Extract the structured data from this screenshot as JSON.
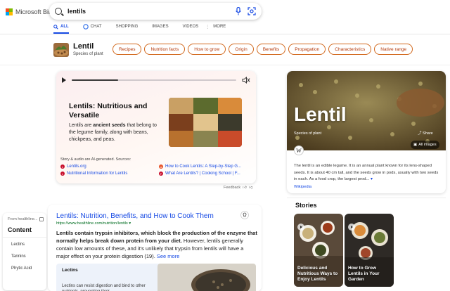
{
  "header": {
    "brand": "Microsoft Bing",
    "brand_colors": [
      "#f25022",
      "#7fba00",
      "#00a4ef",
      "#ffb900"
    ],
    "search_value": "lentils",
    "accent": "#174ae4"
  },
  "nav": {
    "all": "ALL",
    "chat": "CHAT",
    "shopping": "SHOPPING",
    "images": "IMAGES",
    "videos": "VIDEOS",
    "more": "MORE"
  },
  "entity": {
    "title": "Lentil",
    "subtitle": "Species of plant",
    "pills": [
      "Recipes",
      "Nutrition facts",
      "How to grow",
      "Origin",
      "Benefits",
      "Propagation",
      "Characteristics",
      "Native range"
    ]
  },
  "audio_card": {
    "progress": 0.28,
    "title": "Lentils: Nutritious and Versatile",
    "body_pre": "Lentils are ",
    "body_bold": "ancient seeds",
    "body_post": " that belong to the legume family, along with beans, chickpeas, and peas.",
    "sources_label": "Story & audio are AI-generated. Sources:",
    "sources": [
      "Lentils.org",
      "Nutritional Information for Lentils",
      "How to Cook Lentils: A Step-by-Step G...",
      "What Are Lentils? | Cooking School | F..."
    ],
    "feedback": "Feedback"
  },
  "knowledge_panel": {
    "title": "Lentil",
    "subtitle": "Species of plant",
    "share": "Share",
    "all_images": "All images",
    "description": "The lentil is an edible legume. It is an annual plant known for its lens-shaped seeds. It is about 40 cm tall, and the seeds grow in pods, usually with two seeds in each. As a food crop, the largest prod...",
    "more_arrow": "▾",
    "source": "Wikipedia"
  },
  "stories": {
    "title": "Stories",
    "items": [
      "Delicious and Nutritious Ways to Enjoy Lentils",
      "How to Grow Lentils in Your Garden"
    ]
  },
  "toc": {
    "from": "From healthline...",
    "title": "Content",
    "items": [
      "Lectins",
      "Tannins",
      "Phytic Acid"
    ]
  },
  "result": {
    "title": "Lentils: Nutrition, Benefits, and How to Cook Them",
    "url": "https://www.healthline.com/nutrition/lentils",
    "snippet_bold": "Lentils contain trypsin inhibitors, which block the production of the enzyme that normally helps break down protein from your diet.",
    "snippet_rest": " However, lentils generally contain low amounts of these, and it’s unlikely that trypsin from lentils will have a major effect on your protein digestion (19).",
    "see_more": "See more",
    "subsection_title": "Lectins",
    "subsection_text": "Lectins can resist digestion and bind to other nutrients, preventing their"
  }
}
